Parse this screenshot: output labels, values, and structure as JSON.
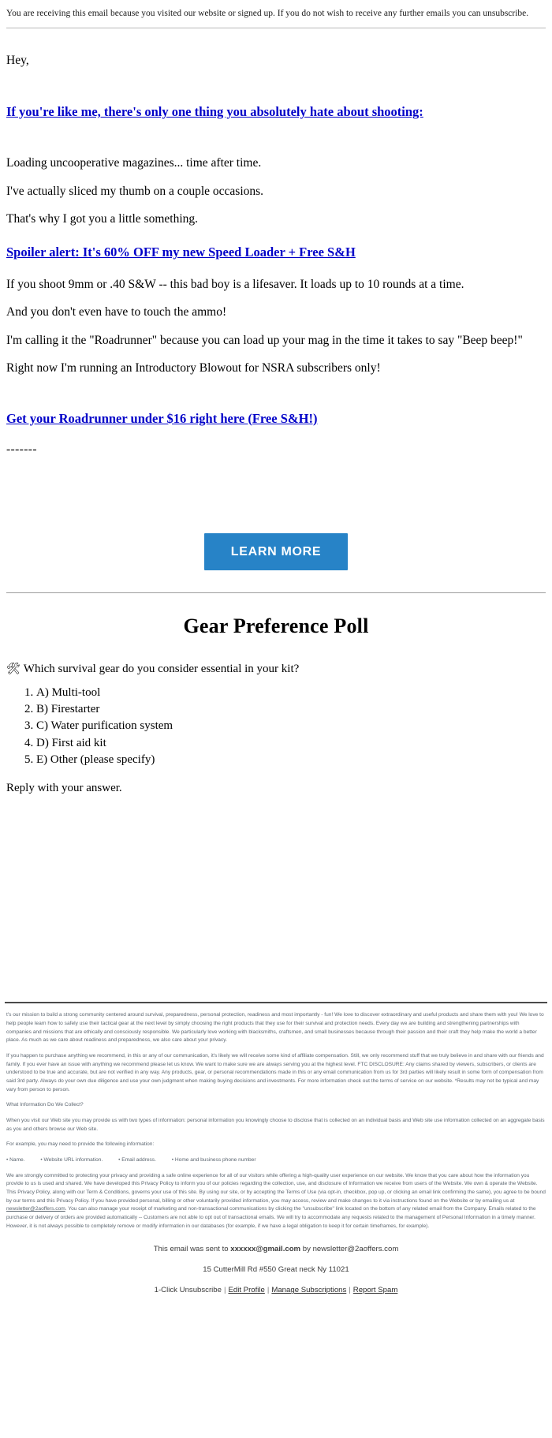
{
  "preheader": {
    "text": "You are receiving this email because you visited our website or signed up. If you do not wish to receive any further emails you can unsubscribe."
  },
  "body": {
    "greeting": "Hey,",
    "headline_link": "If you're like me, there's only one thing you absolutely hate about shooting:",
    "para_1": "Loading uncooperative magazines... time after time.",
    "para_2": "I've actually sliced my thumb on a couple occasions.",
    "para_3": "That's why I got you a little something.",
    "spoiler_link": "Spoiler alert: It's 60% OFF my new Speed Loader + Free S&H",
    "para_4": "If you shoot 9mm or .40 S&W -- this bad boy is a lifesaver. It loads up to 10 rounds at a time.",
    "para_5": "And you don't even have to touch the ammo!",
    "para_6": "I'm calling it the \"Roadrunner\" because you can load up your mag in the time it takes to say \"Beep beep!\"",
    "para_7": "Right now I'm running an Introductory Blowout for NSRA subscribers only!",
    "offer_link": "Get your Roadrunner under $16 right here (Free S&H!)",
    "divider_dashes": "-------"
  },
  "cta": {
    "button_label": "LEARN MORE",
    "button_color": "#2783c7",
    "button_text_color": "#ffffff",
    "link_color": "#0000c8"
  },
  "poll": {
    "title": "Gear Preference Poll",
    "icon": "hammer-and-wrench-emoji",
    "icon_glyph": "🛠",
    "question": "Which survival gear do you consider essential in your kit?",
    "options": [
      "A) Multi-tool",
      "B) Firestarter",
      "C) Water purification system",
      "D) First aid kit",
      "E) Other (please specify)"
    ],
    "reply_note": "Reply with your answer."
  },
  "footer": {
    "mission": "t's our mission to build a strong community centered around survival, preparedness, personal protection, readiness and most importantly - fun! We love to discover extraordinary and useful products and share them with you! We love to help people learn how to safely use their tactical gear at the next level by simply choosing the right products that they use for their survival and protection needs. Every day we are building and strengthening partnerships with companies and missions that are ethically and consciously responsible. We particularly love working with blacksmiths, craftsmen, and small businesses because through their passion and their craft they help make the world a better place. As much as we care about readiness and preparedness, we also care about your privacy.",
    "affiliate": "If you happen to purchase anything we recommend, in this or any of our communication, it's likely we will receive some kind of affiliate compensation. Still, we only recommend stuff that we truly believe in and share with our friends and family. If you ever have an issue with anything we recommend please let us know. We want to make sure we are always serving you at the highest level. FTC DISCLOSURE: Any claims shared by viewers, subscribers, or clients are understood to be true and accurate, but are not verified in any way. Any products, gear, or personal recommendations made in this or any email communication from us for 3rd parties will likely result in some form of compensation from said 3rd party. Always do your own due diligence and use your own judgment when making buying decisions and investments. For more information check out the terms of service on our website. *Results may not be typical and may vary from person to person.",
    "collect_heading": "What Information Do We Collect?",
    "collect_body": "When you visit our Web site you may provide us with two types of information: personal information you knowingly choose to disclose that is collected on an individual basis and Web site use information collected on an aggregate basis as you and others browse our Web site.",
    "example_lead": "For example, you may need to provide the following information:",
    "example_items": [
      "• Name.",
      "• Website URL information.",
      "• Email address.",
      "• Home and business phone number"
    ],
    "privacy_part_1": "We are strongly committed to protecting your privacy and providing a safe online experience for all of our visitors while offering a high-quality user experience on our website. We know that you care about how the information you provide to us is used and shared. We have developed this Privacy Policy to inform you of our policies regarding the collection, use, and disclosure of Information we receive from users of the Website. We own & operate the Website. This Privacy Policy, along with our Term & Conditions, governs your use of this site. By using our site, or by accepting the Terms of Use (via opt-in, checkbox, pop up, or clicking an email link confirming the same), you agree to be bound by our terms and this Privacy Policy. If you have provided personal, billing or other voluntarily provided information, you may access, review and make changes to it via instructions found on the Website or by emailing us at ",
    "privacy_email": "newsletter@2aoffers.com",
    "privacy_part_2": ". You can also manage your receipt of marketing and non-transactional communications by clicking the \"unsubscribe\" link located on the bottom of any related email from the Company. Emails related to the purchase or delivery of orders are provided automatically -- Customers are not able to opt out of transactional emails. We will try to accommodate any requests related to the management of Personal Information in a timely manner. However, it is not always possible to completely remove or modify information in our databases (for example, if we have a legal obligation to keep it for certain timeframes, for example).",
    "sent_to_prefix": "This email was sent to ",
    "sent_to_address": "xxxxxx@gmail.com",
    "sent_by_prefix": " by ",
    "sent_by_address": "newsletter@2aoffers.com",
    "mailing_address": "15 CutterMill Rd #550 Great neck Ny 11021",
    "links": {
      "unsubscribe": "1-Click Unsubscribe",
      "edit_profile": "Edit Profile",
      "manage_subscriptions": "Manage Subscriptions",
      "report_spam": "Report Spam",
      "separator": "|"
    }
  }
}
